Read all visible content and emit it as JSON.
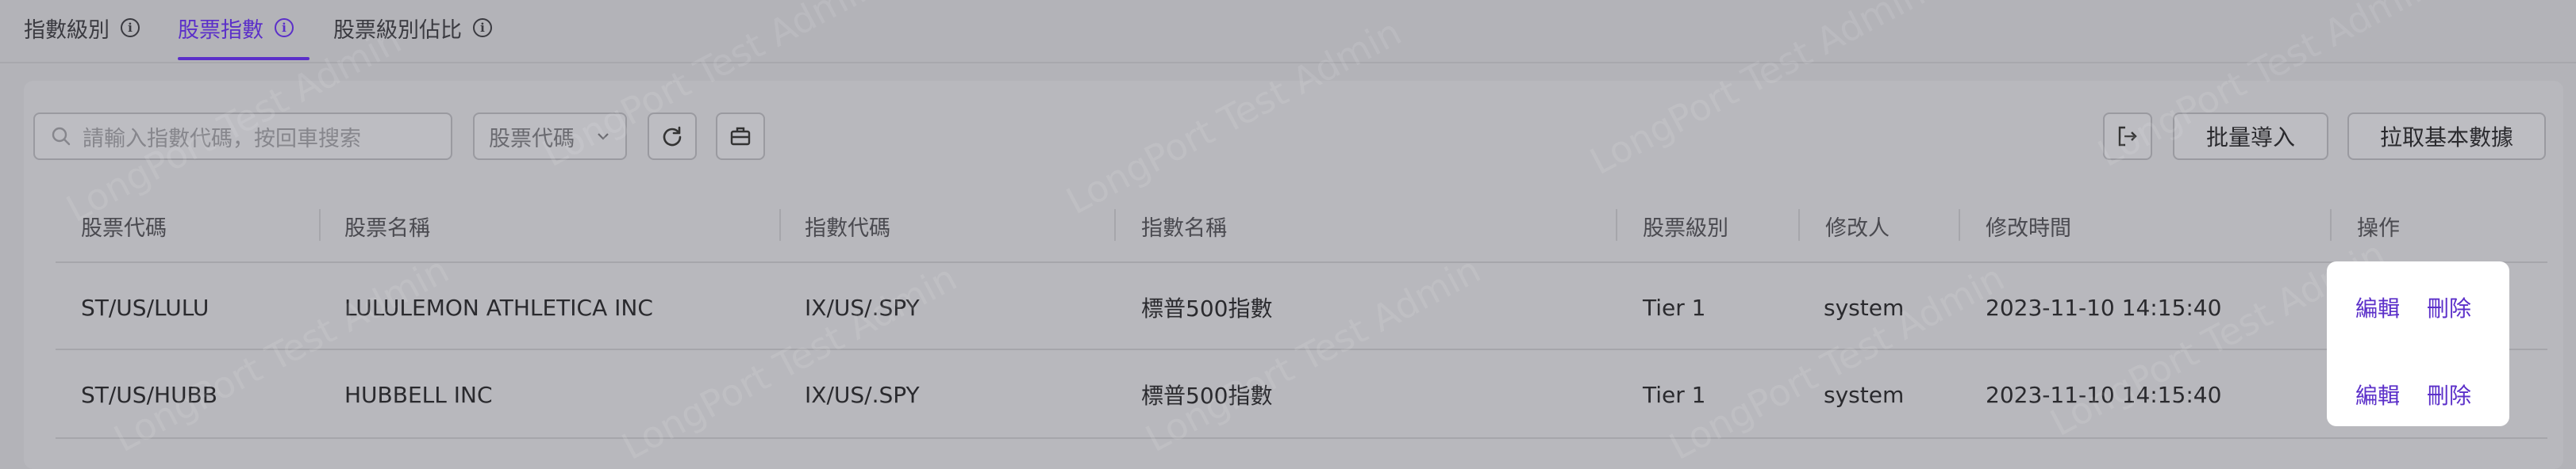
{
  "tabs": [
    {
      "label": "指數級別",
      "active": false
    },
    {
      "label": "股票指數",
      "active": true
    },
    {
      "label": "股票級別佔比",
      "active": false
    }
  ],
  "toolbar": {
    "search_placeholder": "請輸入指數代碼，按回車搜索",
    "filter_select": "股票代碼",
    "import_label": "批量導入",
    "fetch_label": "拉取基本數據"
  },
  "table": {
    "columns": [
      "股票代碼",
      "股票名稱",
      "指數代碼",
      "指數名稱",
      "股票級別",
      "修改人",
      "修改時間",
      "操作"
    ],
    "rows": [
      {
        "stock_code": "ST/US/LULU",
        "stock_name": "LULULEMON ATHLETICA INC",
        "index_code": "IX/US/.SPY",
        "index_name": "標普500指數",
        "level": "Tier 1",
        "modifier": "system",
        "modified_time": "2023-11-10 14:15:40",
        "edit": "編輯",
        "delete": "刪除"
      },
      {
        "stock_code": "ST/US/HUBB",
        "stock_name": "HUBBELL INC",
        "index_code": "IX/US/.SPY",
        "index_name": "標普500指數",
        "level": "Tier 1",
        "modifier": "system",
        "modified_time": "2023-11-10 14:15:40",
        "edit": "編輯",
        "delete": "刪除"
      }
    ]
  },
  "watermark": "LongPort Test Admin",
  "colors": {
    "accent": "#5b2fc9",
    "overlay_bg": "#b3b3b8"
  }
}
